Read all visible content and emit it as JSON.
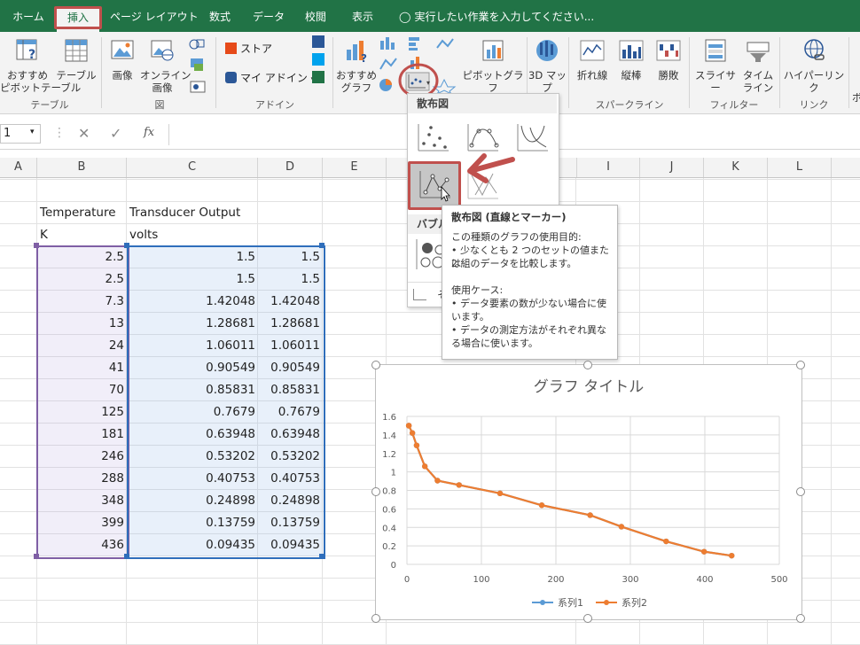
{
  "tabs": [
    {
      "label": "ホーム",
      "active": false
    },
    {
      "label": "挿入",
      "active": true
    },
    {
      "label": "ページ レイアウト",
      "active": false
    },
    {
      "label": "数式",
      "active": false
    },
    {
      "label": "データ",
      "active": false
    },
    {
      "label": "校閲",
      "active": false
    },
    {
      "label": "表示",
      "active": false
    }
  ],
  "tell_me": "実行したい作業を入力してください...",
  "ribbon": {
    "recommended_pivot": "おすすめ\nピボットテーブル",
    "table": "テーブル",
    "picture": "画像",
    "online_picture": "オンライン\n画像",
    "store": "ストア",
    "my_addins": "マイ アドイン",
    "recommended_charts": "おすすめ\nグラフ",
    "pivot_chart": "ピボットグラフ",
    "map_3d": "3D マッ\nプ",
    "line": "折れ線",
    "column": "縦棒",
    "win_loss": "勝敗",
    "slicer": "スライサー",
    "timeline": "タイム\nライン",
    "hyperlink": "ハイパーリンク",
    "cut_right": "ボ",
    "groups": {
      "tables": "テーブル",
      "illustrations": "図",
      "addins": "アドイン",
      "sparklines": "スパークライン",
      "filters": "フィルター",
      "links": "リンク"
    }
  },
  "formula_bar": {
    "name_box": "1",
    "fx": "fx"
  },
  "columns": [
    "A",
    "B",
    "C",
    "D",
    "E",
    "I",
    "J",
    "K",
    "L"
  ],
  "sheet": {
    "header1": [
      "Temperature",
      "Transducer Output"
    ],
    "header2": [
      "K",
      "volts"
    ],
    "rows": [
      [
        "2.5",
        "1.5",
        "1.5"
      ],
      [
        "2.5",
        "1.5",
        "1.5"
      ],
      [
        "7.3",
        "1.42048",
        "1.42048"
      ],
      [
        "13",
        "1.28681",
        "1.28681"
      ],
      [
        "24",
        "1.06011",
        "1.06011"
      ],
      [
        "41",
        "0.90549",
        "0.90549"
      ],
      [
        "70",
        "0.85831",
        "0.85831"
      ],
      [
        "125",
        "0.7679",
        "0.7679"
      ],
      [
        "181",
        "0.63948",
        "0.63948"
      ],
      [
        "246",
        "0.53202",
        "0.53202"
      ],
      [
        "288",
        "0.40753",
        "0.40753"
      ],
      [
        "348",
        "0.24898",
        "0.24898"
      ],
      [
        "399",
        "0.13759",
        "0.13759"
      ],
      [
        "436",
        "0.09435",
        "0.09435"
      ]
    ]
  },
  "dropdown": {
    "scatter_header": "散布図",
    "bubble_header": "バブル",
    "more_label": "そ"
  },
  "tooltip": {
    "title": "散布図 (直線とマーカー)",
    "purpose_title": "この種類のグラフの使用目的:",
    "purpose_lines": [
      "• 少なくとも 2 つのセットの値または",
      "2 組のデータを比較します。"
    ],
    "usage_title": "使用ケース:",
    "usage_lines": [
      "• データ要素の数が少ない場合に使",
      "います。",
      "• データの測定方法がそれぞれ異な",
      "る場合に使います。"
    ]
  },
  "chart_data": {
    "type": "scatter",
    "title": "グラフ タイトル",
    "xlim": [
      0,
      500
    ],
    "ylim": [
      0,
      1.6
    ],
    "x_ticks": [
      "0",
      "100",
      "200",
      "300",
      "400",
      "500"
    ],
    "y_ticks": [
      "0",
      "0.2",
      "0.4",
      "0.6",
      "0.8",
      "1",
      "1.2",
      "1.4",
      "1.6"
    ],
    "x": [
      2.5,
      2.5,
      7.3,
      13,
      24,
      41,
      70,
      125,
      181,
      246,
      288,
      348,
      399,
      436
    ],
    "series": [
      {
        "name": "系列1",
        "color": "#5b9bd5",
        "values": [
          1.5,
          1.5,
          1.42048,
          1.28681,
          1.06011,
          0.90549,
          0.85831,
          0.7679,
          0.63948,
          0.53202,
          0.40753,
          0.24898,
          0.13759,
          0.09435
        ]
      },
      {
        "name": "系列2",
        "color": "#ed7d31",
        "values": [
          1.5,
          1.5,
          1.42048,
          1.28681,
          1.06011,
          0.90549,
          0.85831,
          0.7679,
          0.63948,
          0.53202,
          0.40753,
          0.24898,
          0.13759,
          0.09435
        ]
      }
    ],
    "grid": true,
    "legend_position": "bottom"
  },
  "colors": {
    "excel_green": "#217346",
    "highlight_red": "#c0504d",
    "sel_purple": "#7f5fa5",
    "sel_blue": "#2f6ebb"
  }
}
